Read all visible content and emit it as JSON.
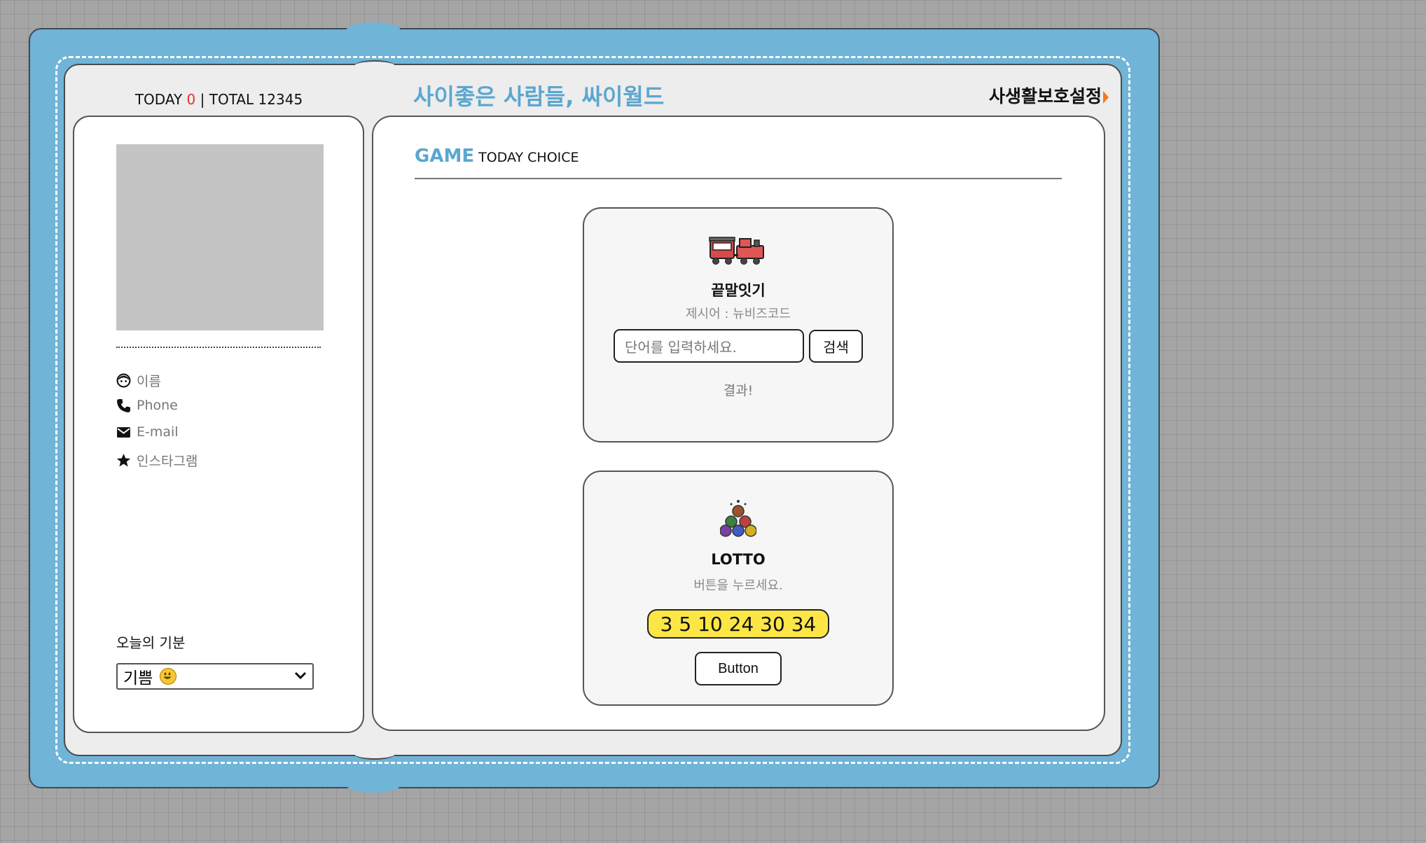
{
  "header": {
    "today_label": "TODAY",
    "today_count": "0",
    "separator": "|",
    "total_label": "TOTAL",
    "total_count": "12345",
    "site_title": "사이좋은 사람들, 싸이월드",
    "privacy_link": "사생활보호설정"
  },
  "profile": {
    "fields": [
      {
        "icon": "face-icon",
        "label": "이름"
      },
      {
        "icon": "phone-icon",
        "label": "Phone"
      },
      {
        "icon": "mail-icon",
        "label": "E-mail"
      },
      {
        "icon": "star-icon",
        "label": "인스타그램"
      }
    ],
    "mood_label": "오늘의 기분",
    "mood_value": "기쁨"
  },
  "game": {
    "title": "GAME",
    "subtitle": "TODAY CHOICE",
    "word_chain": {
      "icon": "train-icon",
      "title": "끝말잇기",
      "prompt": "제시어 : 뉴비즈코드",
      "input_placeholder": "단어를 입력하세요.",
      "search_label": "검색",
      "result": "결과!"
    },
    "lotto": {
      "icon": "lotto-balls-icon",
      "title": "LOTTO",
      "prompt": "버튼을 누르세요.",
      "numbers": "3 5 10 24 30 34",
      "button_label": "Button"
    }
  },
  "colors": {
    "frame": "#70b4d8",
    "accent": "#5aa7cf",
    "today_count": "#e8312b",
    "lotto_bg": "#fbe646",
    "arrow": "#f07921"
  }
}
